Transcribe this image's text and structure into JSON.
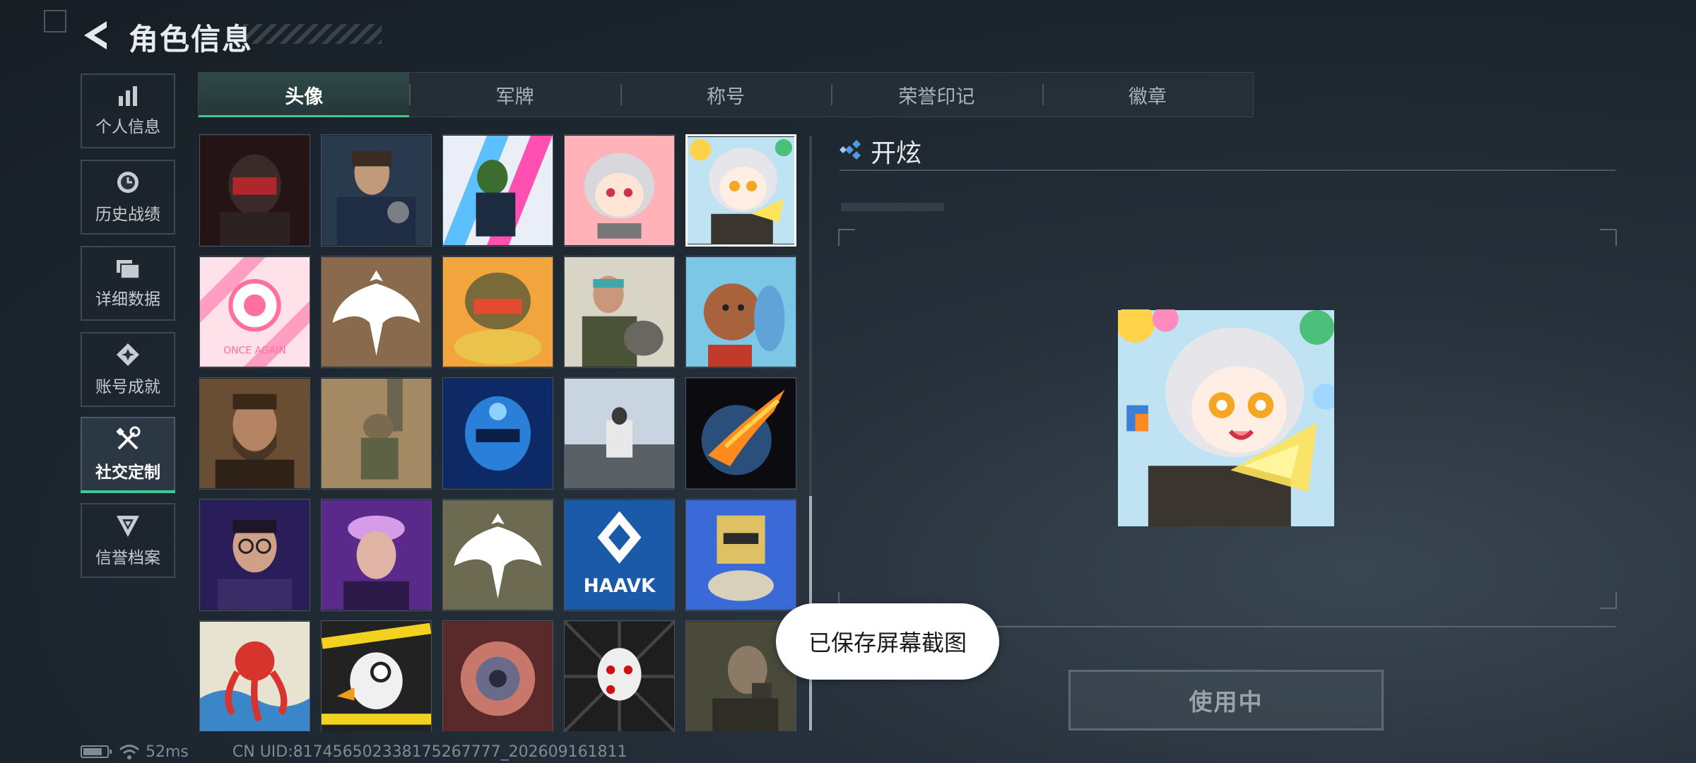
{
  "header": {
    "title": "角色信息"
  },
  "nav": {
    "items": [
      {
        "label": "个人信息",
        "icon": "bar-chart-icon"
      },
      {
        "label": "历史战绩",
        "icon": "clock-icon"
      },
      {
        "label": "详细数据",
        "icon": "folder-icon"
      },
      {
        "label": "账号成就",
        "icon": "achievement-icon"
      },
      {
        "label": "社交定制",
        "icon": "tools-icon",
        "active": true
      },
      {
        "label": "信誉档案",
        "icon": "shield-icon"
      }
    ]
  },
  "tabs": [
    {
      "label": "头像",
      "active": true
    },
    {
      "label": "军牌"
    },
    {
      "label": "称号"
    },
    {
      "label": "荣誉印记"
    },
    {
      "label": "徽章"
    }
  ],
  "avatars": {
    "row1": [
      "soldier-red-mask",
      "officer-with-gun",
      "neon-runner",
      "chibi-girl-pink",
      "chibi-girl-selected"
    ],
    "row2": [
      "once-again",
      "phoenix-emblem-brown",
      "helmet-food",
      "soldier-with-dog",
      "cartoon-bear-fish"
    ],
    "row3": [
      "bearded-man",
      "soldier-climbing",
      "blue-helmet",
      "man-on-chair",
      "burning-planet"
    ],
    "row4": [
      "man-glasses-purple",
      "woman-purple",
      "phoenix-emblem-desert",
      "haavk-logo",
      "robot-totem"
    ],
    "row5": [
      "red-octopus",
      "duck-police-tape",
      "mechanical-eye",
      "masked-puppet",
      "headset-soldier"
    ],
    "once_again_text": "ONCE AGAIN",
    "haavk_text": "HAAVK"
  },
  "detail": {
    "name": "开炫",
    "button_label": "使用中"
  },
  "toast": {
    "text": "已保存屏幕截图"
  },
  "status": {
    "ping": "52ms",
    "uid": "CN UID:817456502338175267777_202609161811"
  },
  "colors": {
    "accent": "#3fc98b",
    "diamond": "#4f9be0"
  }
}
